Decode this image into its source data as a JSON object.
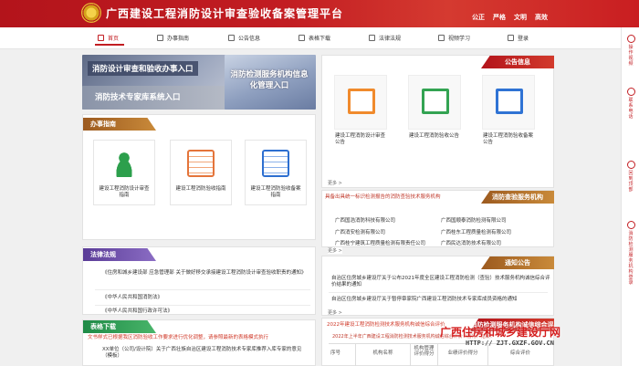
{
  "site_title": "广西建设工程消防设计审查验收备案管理平台",
  "slogan": [
    "公正",
    "严格",
    "文明",
    "高效"
  ],
  "nav": [
    {
      "label": "首页",
      "icon": "home-icon"
    },
    {
      "label": "办事指南",
      "icon": "book-icon"
    },
    {
      "label": "公告信息",
      "icon": "notice-icon"
    },
    {
      "label": "表格下载",
      "icon": "table-icon"
    },
    {
      "label": "法律法规",
      "icon": "scale-icon"
    },
    {
      "label": "视频学习",
      "icon": "video-icon"
    },
    {
      "label": "登录",
      "icon": "user-icon"
    }
  ],
  "right_sidebar": [
    {
      "label": "操作视频",
      "icon": "play-icon"
    },
    {
      "label": "联系电话",
      "icon": "phone-icon"
    },
    {
      "label": "回到顶部",
      "icon": "arrow-up-icon"
    },
    {
      "label": "消防检测服务机构登录",
      "icon": "login-icon"
    }
  ],
  "banners": {
    "main": "消防设计审查和验收办事入口",
    "experts": "消防技术专家库系统入口",
    "testing": "消防检测服务机构信息化管理入口"
  },
  "guide": {
    "title": "办事指南",
    "cards": [
      {
        "label": "建设工程消防设计审查指南",
        "icon": "reviewer-icon"
      },
      {
        "label": "建设工程消防验收指南",
        "icon": "checklist-icon"
      },
      {
        "label": "建设工程消防验收备案指南",
        "icon": "verify-icon"
      }
    ]
  },
  "laws": {
    "title": "法律法规",
    "items": [
      "《住房和城乡建设部 应急管理部 关于做好移交承接建设工程消防设计审查验收职责的通知》",
      "《中华人民共和国消防法》",
      "《中华人民共和国行政许可法》"
    ]
  },
  "downloads": {
    "title": "表格下载",
    "notice": "文书样式已根据我区消防验收工作要求进行优化调整，请参照最新的表格模式执行",
    "items": [
      "XX单位（公司/设计院）关于广西壮族自治区建设工程消防技术专家库推荐入库专家的意见（模板）"
    ]
  },
  "announcements": {
    "title": "公告信息",
    "items": [
      {
        "label": "建设工程消防设计审查公告",
        "icon": "orange-book-icon"
      },
      {
        "label": "建设工程消防验收公告",
        "icon": "green-book-icon"
      },
      {
        "label": "建设工程消防验收备案公告",
        "icon": "blue-book-icon"
      }
    ],
    "more": "更多 >"
  },
  "agencies": {
    "subtitle": "具备出具统一标识检测报告的消防查验技术服务机构",
    "title": "消防查验服务机构",
    "items": [
      "广西国浩消防科技有限公司",
      "广西国顺泰消防检测有限公司",
      "广西消安检测有限公司",
      "广西桂东工程质量检测有限公司",
      "广西桂宁建筑工程质量检测有限责任公司",
      "广西民达消防技术有限公司"
    ],
    "more": "更多 >"
  },
  "notices": {
    "title": "通知公告",
    "items": [
      "自治区住房城乡建设厅关于公布2021年度全区建设工程消防检测（查验）技术服务机构诚信综合评价结果的通知",
      "自治区住房城乡建设厅关于暂停章家院广西建设工程消防技术专家库成员资格的通知"
    ],
    "more": "更多 >"
  },
  "evaluation": {
    "title": "消防检测服务机构诚信综合评价",
    "subtitle": "2022年建设工程消防检测技术服务机构诚信综合评价",
    "desc": "2022年上半年广西建设工程消防检测技术服务机构诚信综合评价（暂行）结果：",
    "table_headers": [
      "序号",
      "机构名称",
      "机构管理评价得分",
      "业绩评价得分",
      "综合评价"
    ]
  },
  "watermark": {
    "line1": "广西住房和城乡建设厅网",
    "line2": "HTTP:// ZJT.GXZF.GOV.CN"
  }
}
